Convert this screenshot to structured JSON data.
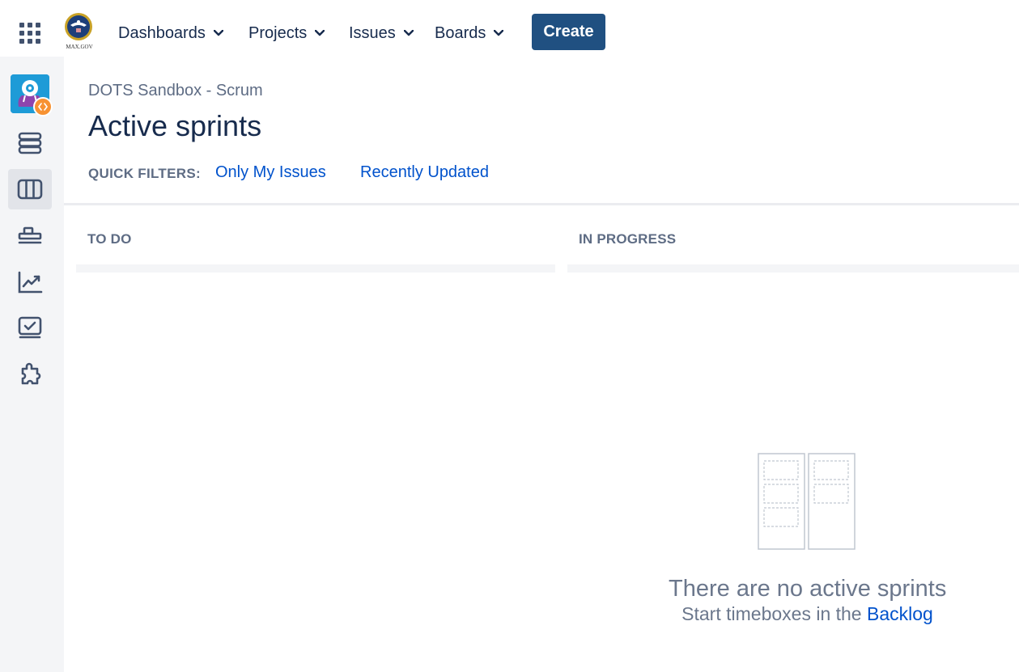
{
  "topbar": {
    "logo_text": "MAX.GOV",
    "nav": [
      {
        "label": "Dashboards"
      },
      {
        "label": "Projects"
      },
      {
        "label": "Issues"
      },
      {
        "label": "Boards"
      }
    ],
    "create_label": "Create"
  },
  "sidebar": {
    "items": [
      {
        "icon": "backlog-icon"
      },
      {
        "icon": "board-icon",
        "active": true
      },
      {
        "icon": "releases-icon"
      },
      {
        "icon": "reports-icon"
      },
      {
        "icon": "issues-icon"
      },
      {
        "icon": "add-ons-icon"
      }
    ]
  },
  "main": {
    "breadcrumb": "DOTS Sandbox - Scrum",
    "title": "Active sprints",
    "quick_filters": {
      "label": "QUICK FILTERS:",
      "items": [
        "Only My Issues",
        "Recently Updated"
      ]
    },
    "columns": [
      "TO DO",
      "IN PROGRESS"
    ],
    "empty_state": {
      "title": "There are no active sprints",
      "subtitle_prefix": "Start timeboxes in the",
      "link": "Backlog"
    }
  },
  "colors": {
    "primary_button": "#205081",
    "link": "#0052cc",
    "sidebar_bg": "#f4f5f7",
    "text": "#172b4d",
    "muted_text": "#5e6c84"
  }
}
